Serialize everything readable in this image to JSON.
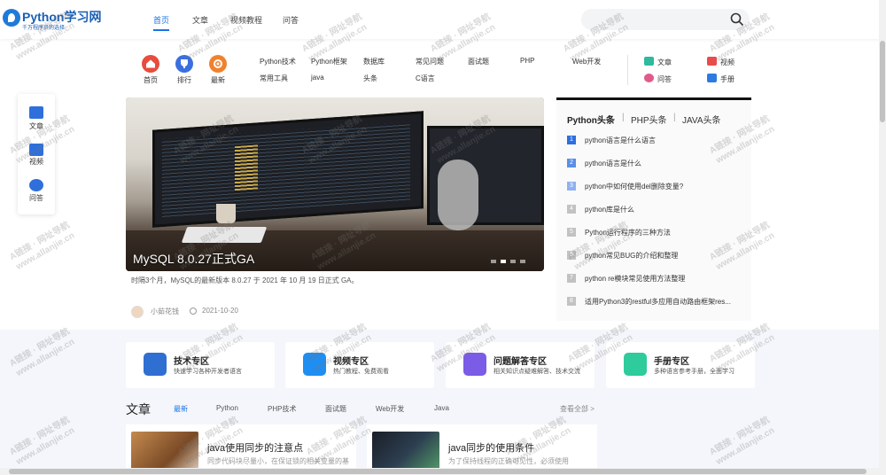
{
  "header": {
    "logo_title": "Python学习网",
    "logo_subtitle": "千万程序员的选择",
    "nav": [
      "首页",
      "文章",
      "视频教程",
      "问答"
    ]
  },
  "quick_nav": {
    "circles": [
      {
        "label": "首页",
        "color": "#e74c3c"
      },
      {
        "label": "排行",
        "color": "#3b6fe0"
      },
      {
        "label": "最新",
        "color": "#f0822d"
      }
    ],
    "row1": [
      "Python技术",
      "Python框架",
      "数据库",
      "常见问题",
      "面试题",
      "PHP",
      "Web开发"
    ],
    "row2": [
      "常用工具",
      "java",
      "头条",
      "C语言"
    ],
    "right_links": [
      "文章",
      "视频",
      "问答",
      "手册"
    ]
  },
  "side_float": [
    "文章",
    "视频",
    "问答"
  ],
  "banner": {
    "title": "MySQL 8.0.27正式GA",
    "description": "时隔3个月，MySQL的最新版本 8.0.27 于 2021 年 10 月 19 日正式 GA。",
    "author": "小茹花钱",
    "date": "2021-10-20"
  },
  "headlines": {
    "tabs": [
      "Python头条",
      "PHP头条",
      "JAVA头条"
    ],
    "items": [
      {
        "num": "1",
        "text": "python语言是什么语言"
      },
      {
        "num": "2",
        "text": "python语言是什么"
      },
      {
        "num": "3",
        "text": "python中如何使用del删除变量?"
      },
      {
        "num": "4",
        "text": "python库是什么"
      },
      {
        "num": "5",
        "text": "Python运行程序的三种方法"
      },
      {
        "num": "6",
        "text": "python常见BUG的介绍和整理"
      },
      {
        "num": "7",
        "text": "python re模块常见使用方法整理"
      },
      {
        "num": "8",
        "text": "适用Python3的restful多应用自动路由框架res..."
      }
    ]
  },
  "zones": [
    {
      "title": "技术专区",
      "subtitle": "快速学习各种开发者语言",
      "color": "#2f6fd1"
    },
    {
      "title": "视频专区",
      "subtitle": "热门教程、免费观看",
      "color": "#1f8ef2"
    },
    {
      "title": "问题解答专区",
      "subtitle": "相关知识点疑难解答、技术交流",
      "color": "#7b5ce6"
    },
    {
      "title": "手册专区",
      "subtitle": "多种语言参考手册，全面学习",
      "color": "#2ecb9c"
    }
  ],
  "articles": {
    "heading": "文章",
    "tabs": [
      "最新",
      "Python",
      "PHP技术",
      "面试题",
      "Web开发",
      "Java"
    ],
    "view_all": "查看全部 >",
    "items": [
      {
        "title": "java使用同步的注意点",
        "summary": "同步代码块尽量小，在保证锁的相关变量的基"
      },
      {
        "title": "java同步的使用条件",
        "summary": "为了保持线程的正确可见性，必须使用"
      }
    ]
  },
  "watermark": {
    "line1": "A链接 · 网址导航",
    "line2": "www.allanjie.cn"
  }
}
